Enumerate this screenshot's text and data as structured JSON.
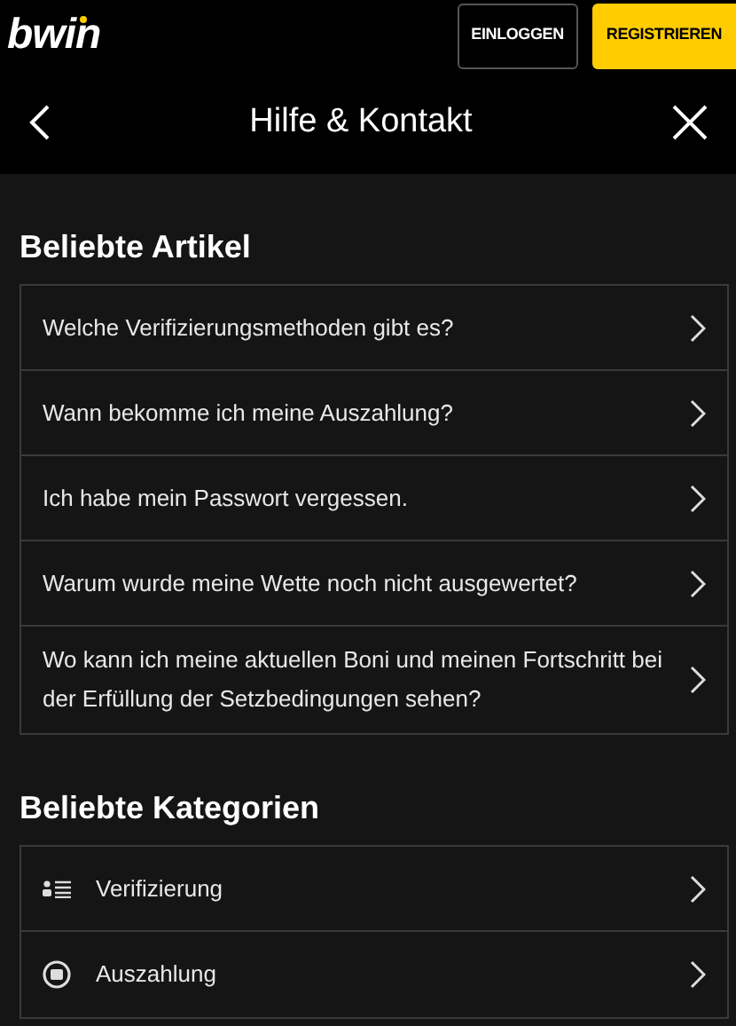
{
  "header": {
    "logo": "bwin",
    "buttons": [
      {
        "label": "EINLOGGEN",
        "kind": "outline"
      },
      {
        "label": "REGISTRIEREN",
        "kind": "primary"
      }
    ]
  },
  "nav": {
    "title": "Hilfe & Kontakt"
  },
  "sections": [
    {
      "title": "Beliebte Artikel",
      "items": [
        {
          "label": "Welche Verifizierungsmethoden gibt es?"
        },
        {
          "label": "Wann bekomme ich meine Auszahlung?"
        },
        {
          "label": "Ich habe mein Passwort vergessen."
        },
        {
          "label": "Warum wurde meine Wette noch nicht ausgewertet?"
        },
        {
          "label": "Wo kann ich meine aktuellen Boni und meinen Fortschritt bei der Erfüllung der Setzbedingungen sehen?"
        }
      ]
    },
    {
      "title": "Beliebte Kategorien",
      "items": [
        {
          "label": "Verifizierung"
        },
        {
          "label": "Auszahlung"
        }
      ]
    }
  ]
}
